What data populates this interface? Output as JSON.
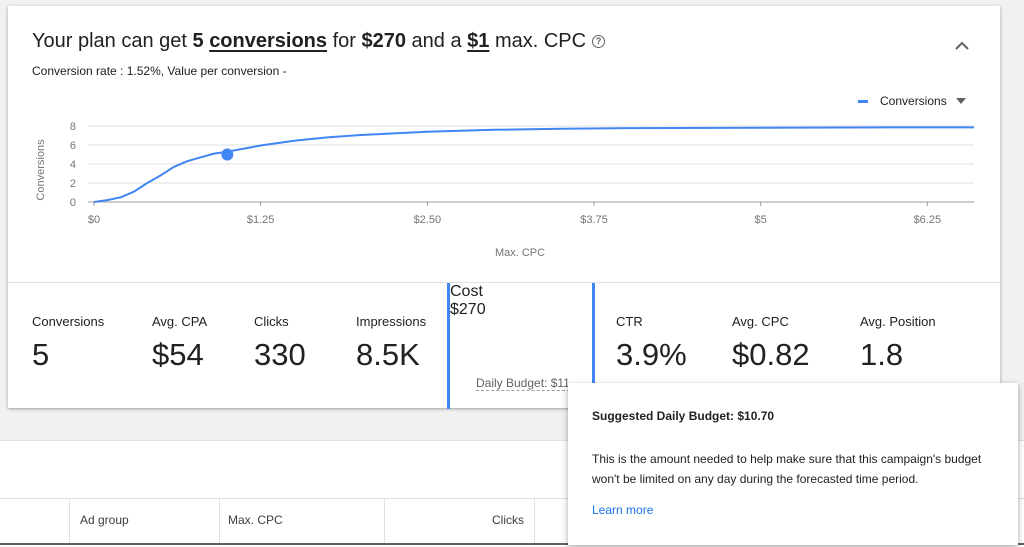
{
  "headline": {
    "prefix": "Your plan can get ",
    "conversions_count": "5",
    "conversions_word": "conversions",
    "mid1": " for ",
    "cost": "$270",
    "mid2": " and a ",
    "max_cpc": "$1",
    "suffix": " max. CPC"
  },
  "subline": "Conversion rate : 1.52%, Value per conversion -",
  "legend": {
    "label": "Conversions",
    "color": "#4285f4"
  },
  "chart_data": {
    "type": "line",
    "xlabel": "Max. CPC",
    "ylabel": "Conversions",
    "xlim": [
      0,
      6.6
    ],
    "ylim": [
      0,
      8
    ],
    "x_ticks": [
      0,
      1.25,
      2.5,
      3.75,
      5,
      6.25
    ],
    "x_tick_labels": [
      "$0",
      "$1.25",
      "$2.50",
      "$3.75",
      "$5",
      "$6.25"
    ],
    "y_ticks": [
      0,
      2,
      4,
      6,
      8
    ],
    "y_tick_labels": [
      "0",
      "2",
      "4",
      "6",
      "8"
    ],
    "series": [
      {
        "name": "Conversions",
        "x": [
          0,
          0.1,
          0.2,
          0.3,
          0.4,
          0.5,
          0.6,
          0.7,
          0.8,
          0.9,
          1.0,
          1.25,
          1.5,
          1.75,
          2.0,
          2.5,
          3.0,
          3.5,
          4.0,
          5.0,
          6.0,
          6.6
        ],
        "y": [
          0,
          0.2,
          0.5,
          1.1,
          2.0,
          2.8,
          3.7,
          4.3,
          4.7,
          5.1,
          5.3,
          5.95,
          6.45,
          6.8,
          7.05,
          7.4,
          7.6,
          7.7,
          7.78,
          7.82,
          7.85,
          7.85
        ]
      }
    ],
    "marker": {
      "x": 1.0,
      "y": 5.0
    },
    "grid": true
  },
  "stats": [
    {
      "label": "Conversions",
      "value": "5"
    },
    {
      "label": "Avg. CPA",
      "value": "$54"
    },
    {
      "label": "Clicks",
      "value": "330"
    },
    {
      "label": "Impressions",
      "value": "8.5K"
    },
    {
      "label": "Cost",
      "value": "$270",
      "sub": "Daily Budget: $11"
    },
    {
      "label": "CTR",
      "value": "3.9%"
    },
    {
      "label": "Avg. CPC",
      "value": "$0.82"
    },
    {
      "label": "Avg. Position",
      "value": "1.8"
    }
  ],
  "table": {
    "columns": [
      "Ad group",
      "Max. CPC",
      "Clicks"
    ]
  },
  "tooltip": {
    "title": "Suggested Daily Budget: $10.70",
    "body": "This is the amount needed to help make sure that this campaign's budget won't be limited on any day during the forecasted time period.",
    "link": "Learn more"
  }
}
